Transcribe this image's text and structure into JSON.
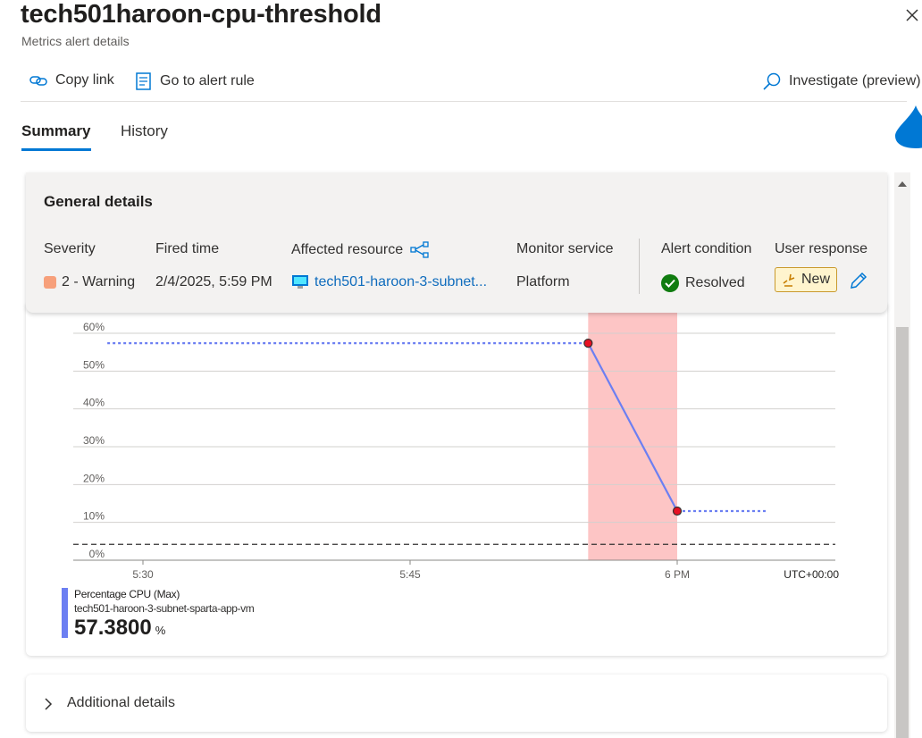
{
  "header": {
    "title": "tech501haroon-cpu-threshold",
    "subtitle": "Metrics alert details"
  },
  "toolbar": {
    "copy_link": "Copy link",
    "go_to_rule": "Go to alert rule",
    "investigate": "Investigate (preview)"
  },
  "tabs": {
    "summary": "Summary",
    "history": "History"
  },
  "general": {
    "title": "General details",
    "severity_label": "Severity",
    "severity_value": "2 - Warning",
    "fired_label": "Fired time",
    "fired_value": "2/4/2025, 5:59 PM",
    "resource_label": "Affected resource",
    "resource_value": "tech501-haroon-3-subnet...",
    "monitor_label": "Monitor service",
    "monitor_value": "Platform",
    "condition_label": "Alert condition",
    "condition_value": "Resolved",
    "response_label": "User response",
    "response_value": "New"
  },
  "chart_data": {
    "type": "line",
    "y_ticks": [
      "60%",
      "50%",
      "40%",
      "30%",
      "20%",
      "10%",
      "0%"
    ],
    "x_ticks": [
      "5:30",
      "5:45",
      "6 PM"
    ],
    "timezone": "UTC+00:00",
    "ylim": [
      0,
      60
    ],
    "threshold": 4.2,
    "series": [
      {
        "name": "Percentage CPU (Max)",
        "color": "#6c7ff2",
        "points": [
          {
            "x": "5:28",
            "y": 57.38,
            "style": "dotted"
          },
          {
            "x": "5:55",
            "y": 57.38,
            "style": "solid",
            "marker": true
          },
          {
            "x": "6:00",
            "y": 13,
            "style": "dotted",
            "marker": true
          },
          {
            "x": "6:05",
            "y": 13,
            "style": "dotted"
          }
        ]
      }
    ],
    "alert_window": {
      "start": "5:55",
      "end": "6:00"
    }
  },
  "legend": {
    "metric": "Percentage CPU (Max)",
    "resource": "tech501-haroon-3-subnet-sparta-app-vm",
    "value": "57.3800",
    "unit": "%"
  },
  "additional": {
    "label": "Additional details"
  },
  "colors": {
    "accent": "#0078d4",
    "warning": "#f7a07b",
    "resolved": "#107c10",
    "alert_band": "#fdc5c5"
  }
}
